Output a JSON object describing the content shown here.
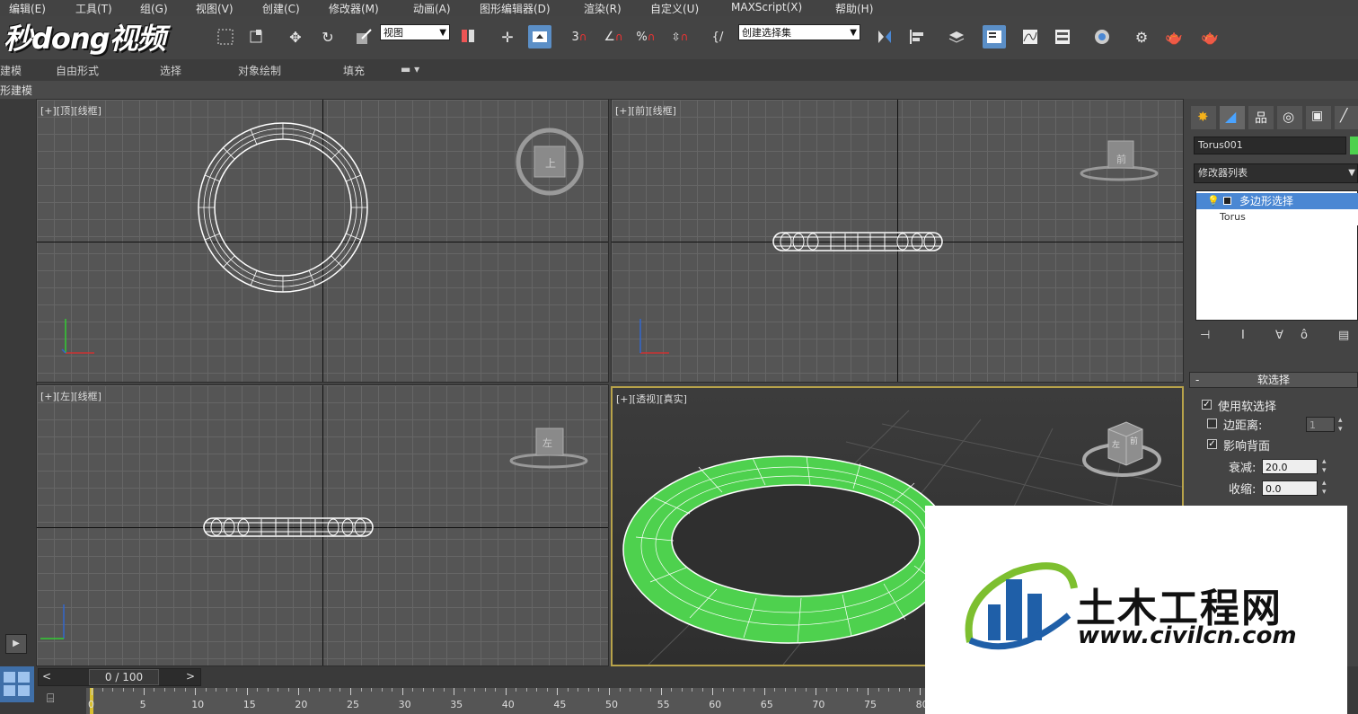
{
  "menu": [
    "编辑(E)",
    "工具(T)",
    "组(G)",
    "视图(V)",
    "创建(C)",
    "修改器(M)",
    "动画(A)",
    "图形编辑器(D)",
    "渲染(R)",
    "自定义(U)",
    "MAXScript(X)",
    "帮助(H)"
  ],
  "toolbar": {
    "view_dropdown": "视图",
    "selection_set": "创建选择集"
  },
  "brand_overlay": "秒dong视频",
  "ribbon": {
    "tabs": [
      "建模",
      "自由形式",
      "选择",
      "对象绘制",
      "填充"
    ],
    "sub_label": "形建模"
  },
  "viewports": {
    "top": "[+][顶][线框]",
    "front": "[+][前][线框]",
    "left": "[+][左][线框]",
    "persp": "[+][透视][真实]",
    "viewcube_top": "上",
    "viewcube_front": "前",
    "viewcube_left": "左",
    "viewcube_persp_a": "左",
    "viewcube_persp_b": "前"
  },
  "command_panel": {
    "object_name": "Torus001",
    "modifier_list": "修改器列表",
    "stack": [
      "多边形选择",
      "Torus"
    ],
    "rollout_title": "软选择",
    "use_soft": "使用软选择",
    "edge_distance": "边距离:",
    "edge_distance_value": "1",
    "affect_backfacing": "影响背面",
    "falloff_label": "衰减:",
    "falloff_value": "20.0",
    "pinch_label": "收缩:",
    "pinch_value": "0.0"
  },
  "timeline": {
    "frame": "0 / 100",
    "ticks": [
      "0",
      "5",
      "10",
      "15",
      "20",
      "25",
      "30",
      "35",
      "40",
      "45",
      "50",
      "55",
      "60",
      "65",
      "70",
      "75",
      "80"
    ]
  },
  "watermark": {
    "title": "土木工程网",
    "url": "www.civilcn.com"
  },
  "colors": {
    "selected_object": "#4ed14e",
    "selection_blue": "#4a87d3",
    "active_border": "#b8a34a"
  }
}
